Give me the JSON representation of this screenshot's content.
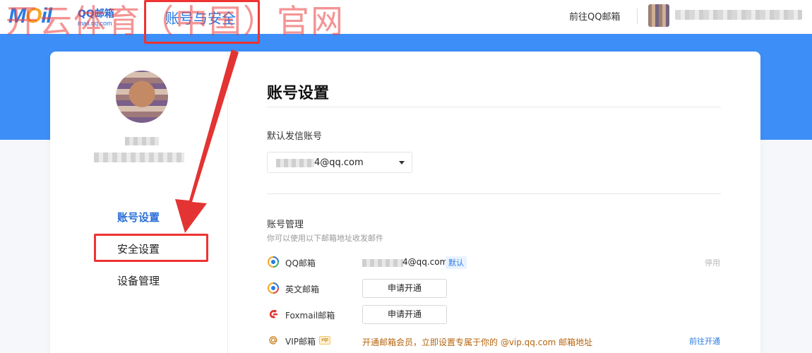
{
  "header": {
    "logo_text": "MOil",
    "logo_name": "QQ邮箱",
    "logo_domain": "mail.qq.com",
    "title": "账号与安全",
    "goto_qq_label": "前往QQ邮箱"
  },
  "watermark_text": "开云体育（中国）官网",
  "sidebar": {
    "items": [
      {
        "label": "账号设置",
        "active": true
      },
      {
        "label": "安全设置",
        "active": false
      },
      {
        "label": "设备管理",
        "active": false
      }
    ]
  },
  "main": {
    "page_title": "账号设置",
    "default_sender": {
      "label": "默认发信账号",
      "value": "4@qq.com"
    },
    "account_mgmt": {
      "label": "账号管理",
      "hint": "你可以使用以下邮箱地址收发邮件",
      "rows": [
        {
          "icon": "qq-mail-icon",
          "name": "QQ邮箱",
          "email": "4@qq.com",
          "badge": "默认",
          "action": "停用"
        },
        {
          "icon": "english-mail-icon",
          "name": "英文邮箱",
          "button": "申请开通"
        },
        {
          "icon": "foxmail-icon",
          "name": "Foxmail邮箱",
          "button": "申请开通"
        },
        {
          "icon": "at-icon",
          "name": "VIP邮箱",
          "vip_badge": "vip",
          "description": "开通邮箱会员，立即设置专属于你的 @vip.qq.com 邮箱地址",
          "action": "前往开通"
        }
      ]
    }
  },
  "colors": {
    "accent": "#2a7be4",
    "banner": "#3d8ef7",
    "annotation": "#e33333",
    "vip_text": "#b4650f"
  }
}
